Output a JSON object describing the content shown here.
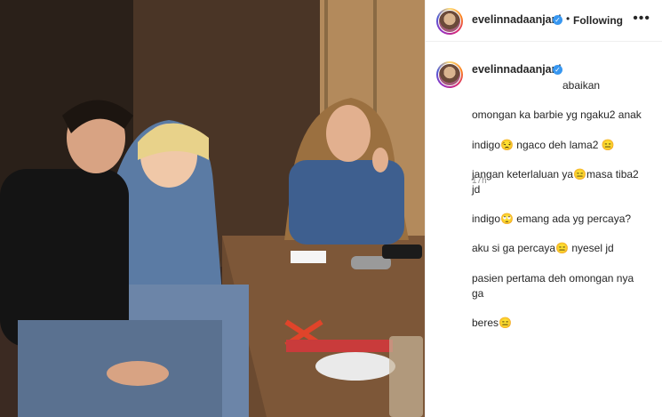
{
  "post": {
    "author": "evelinnadaanjani",
    "follow_status": "Following",
    "more_icon": "more-icon",
    "caption_author": "evelinnadaanjani",
    "caption_lines": [
      "abaikan",
      "omongan ka barbie yg ngaku2 anak",
      "indigo😒  ngaco deh lama2 😑",
      "jangan keterlaluan ya😑masa tiba2 jd",
      "indigo🙄   emang ada yg percaya?",
      "aku si ga percaya😑   nyesel jd",
      "pasien pertama deh omongan nya ga",
      "beres😑"
    ],
    "time": "17h"
  },
  "colors": {
    "verified": "#3897f0",
    "muted": "#8e8e8e",
    "text": "#262626"
  }
}
